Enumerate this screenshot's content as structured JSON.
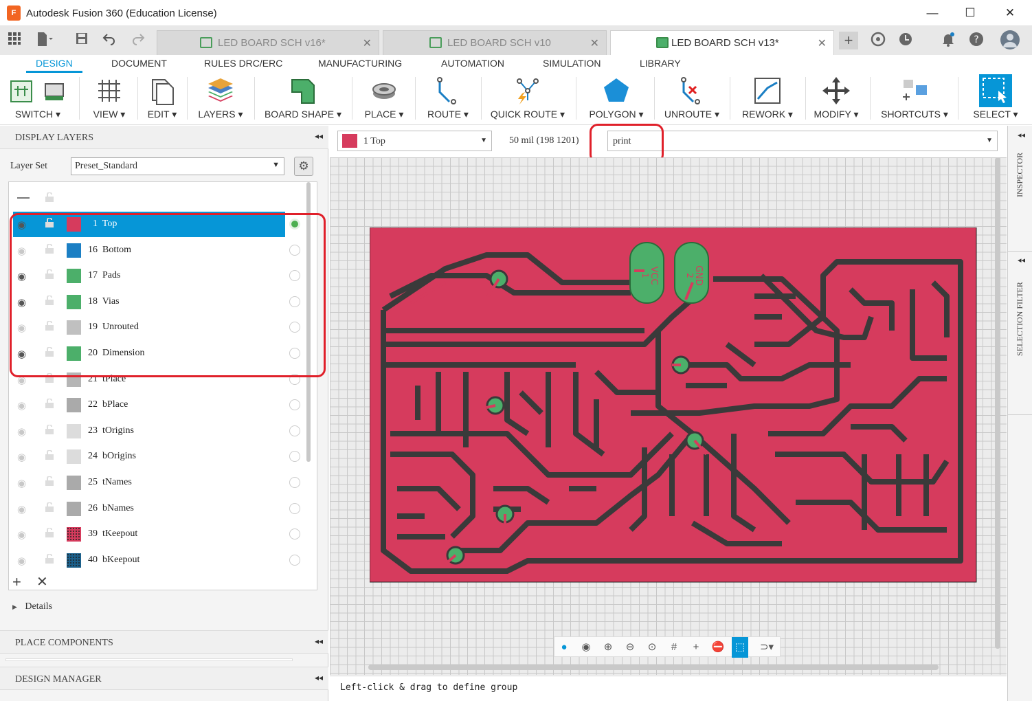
{
  "window": {
    "title": "Autodesk Fusion 360 (Education License)",
    "app_icon_letter": "F",
    "minimize": "—",
    "maximize": "☐",
    "close": "✕"
  },
  "tabs": [
    {
      "label": "LED BOARD SCH v16*",
      "active": false
    },
    {
      "label": "LED BOARD SCH v10",
      "active": false
    },
    {
      "label": "LED BOARD SCH v13*",
      "active": true
    }
  ],
  "topbar": {
    "job_count": "1"
  },
  "ribbon_tabs": [
    "DESIGN",
    "DOCUMENT",
    "RULES DRC/ERC",
    "MANUFACTURING",
    "AUTOMATION",
    "SIMULATION",
    "LIBRARY"
  ],
  "ribbon": {
    "switch": "SWITCH ▾",
    "view": "VIEW ▾",
    "edit": "EDIT ▾",
    "layers": "LAYERS ▾",
    "board_shape": "BOARD SHAPE ▾",
    "place": "PLACE ▾",
    "route": "ROUTE ▾",
    "quick_route": "QUICK ROUTE ▾",
    "polygon": "POLYGON ▾",
    "unroute": "UNROUTE ▾",
    "rework": "REWORK ▾",
    "modify": "MODIFY ▾",
    "shortcuts": "SHORTCUTS ▾",
    "select": "SELECT ▾"
  },
  "display_layers": {
    "header": "DISPLAY LAYERS",
    "layer_set_label": "Layer Set",
    "layer_set_value": "Preset_Standard",
    "layers": [
      {
        "name": "1  Top",
        "color": "#d63b5d",
        "visible": true,
        "selected": true,
        "active": true
      },
      {
        "name": "16  Bottom",
        "color": "#1b7fc4",
        "visible": false
      },
      {
        "name": "17  Pads",
        "color": "#4caf6a",
        "visible": true
      },
      {
        "name": "18  Vias",
        "color": "#4caf6a",
        "visible": true
      },
      {
        "name": "19  Unrouted",
        "color": "#c0c0c0",
        "visible": false
      },
      {
        "name": "20  Dimension",
        "color": "#4caf6a",
        "visible": true
      },
      {
        "name": "21  tPlace",
        "color": "#b5b5b5",
        "visible": false
      },
      {
        "name": "22  bPlace",
        "color": "#aaaaaa",
        "visible": false
      },
      {
        "name": "23  tOrigins",
        "color": "#dcdcdc",
        "visible": false
      },
      {
        "name": "24  bOrigins",
        "color": "#dcdcdc",
        "visible": false
      },
      {
        "name": "25  tNames",
        "color": "#aaaaaa",
        "visible": false
      },
      {
        "name": "26  bNames",
        "color": "#aaaaaa",
        "visible": false
      },
      {
        "name": "39  tKeepout",
        "color": "#d63b5d",
        "visible": false
      },
      {
        "name": "40  bKeepout",
        "color": "#1b5f8a",
        "visible": false
      }
    ],
    "details": "Details"
  },
  "panels": {
    "place_components": "PLACE COMPONENTS",
    "design_manager": "DESIGN MANAGER",
    "inspector": "INSPECTOR",
    "selection_filter": "SELECTION FILTER"
  },
  "canvas_toolbar": {
    "current_layer": "1 Top",
    "grid_info": "50 mil (198 1201)",
    "command_value": "print"
  },
  "board": {
    "labels": [
      "VCC",
      "GND"
    ],
    "pad_labels": [
      "1",
      "2"
    ]
  },
  "status": {
    "hint": "Left-click & drag to define group"
  },
  "colors": {
    "accent": "#0696d7",
    "copper_top": "#d63b5d",
    "pad": "#4caf6a",
    "annotation": "#e0202a"
  }
}
